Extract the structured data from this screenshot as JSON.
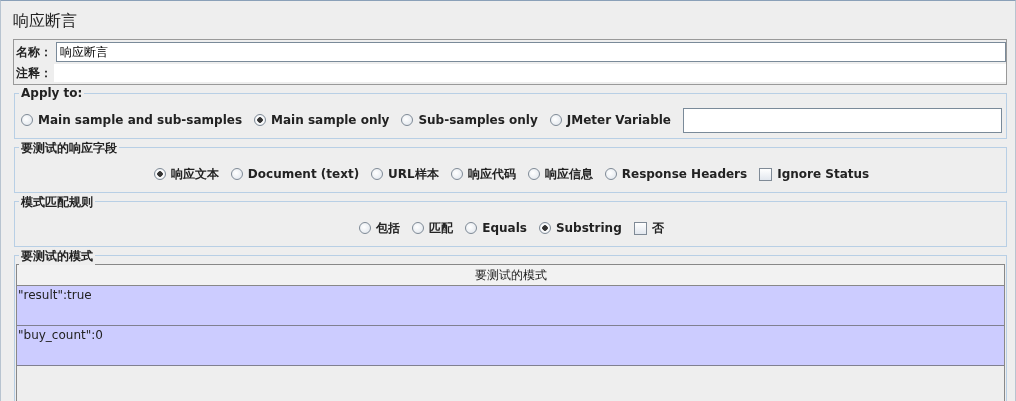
{
  "title": "响应断言",
  "name_field": {
    "label": "名称：",
    "value": "响应断言"
  },
  "comment_field": {
    "label": "注释："
  },
  "apply_to": {
    "legend": "Apply to:",
    "options": [
      {
        "label": "Main sample and sub-samples",
        "selected": false
      },
      {
        "label": "Main sample only",
        "selected": true
      },
      {
        "label": "Sub-samples only",
        "selected": false
      },
      {
        "label": "JMeter Variable",
        "selected": false
      }
    ]
  },
  "response_field": {
    "legend": "要测试的响应字段",
    "options": [
      {
        "kind": "radio",
        "label": "响应文本",
        "selected": true
      },
      {
        "kind": "radio",
        "label": "Document (text)",
        "selected": false
      },
      {
        "kind": "radio",
        "label": "URL样本",
        "selected": false
      },
      {
        "kind": "radio",
        "label": "响应代码",
        "selected": false
      },
      {
        "kind": "radio",
        "label": "响应信息",
        "selected": false
      },
      {
        "kind": "radio",
        "label": "Response Headers",
        "selected": false
      },
      {
        "kind": "checkbox",
        "label": "Ignore Status",
        "checked": false
      }
    ]
  },
  "pattern_rules": {
    "legend": "模式匹配规则",
    "options": [
      {
        "kind": "radio",
        "label": "包括",
        "selected": false
      },
      {
        "kind": "radio",
        "label": "匹配",
        "selected": false
      },
      {
        "kind": "radio",
        "label": "Equals",
        "selected": false
      },
      {
        "kind": "radio",
        "label": "Substring",
        "selected": true
      },
      {
        "kind": "checkbox",
        "label": "否",
        "checked": false
      }
    ]
  },
  "patterns": {
    "legend": "要测试的模式",
    "column": "要测试的模式",
    "rows": [
      {
        "text": "\"result\":true",
        "selected": true
      },
      {
        "text": "\"buy_count\":0",
        "selected": true
      }
    ]
  }
}
